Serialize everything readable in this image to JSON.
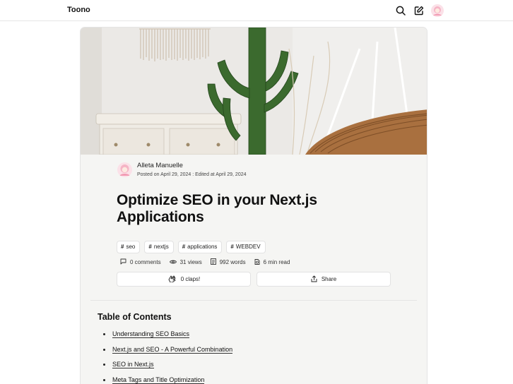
{
  "header": {
    "brand": "Toono",
    "icons": [
      "search-icon",
      "edit-icon",
      "avatar"
    ]
  },
  "article": {
    "author": {
      "name": "Alleta Manuelle",
      "meta": "Posted on April 29, 2024 : Edited at April 29, 2024"
    },
    "title": "Optimize SEO in your Next.js Applications",
    "tags": [
      "seo",
      "nextjs",
      "applications",
      "WEBDEV"
    ],
    "stats": {
      "comments": "0 comments",
      "views": "31 views",
      "words": "992 words",
      "read_time": "6 min read"
    },
    "actions": {
      "claps_label": "0 claps!",
      "share_label": "Share"
    }
  },
  "toc": {
    "title": "Table of Contents",
    "items": [
      "Understanding SEO Basics",
      "Next.js and SEO - A Powerful Combination",
      "SEO in Next.js",
      "Meta Tags and Title Optimization"
    ]
  },
  "colors": {
    "background": "#ffffff",
    "card": "#f5f5f3",
    "border": "#e4e4e4",
    "text": "#111111"
  }
}
